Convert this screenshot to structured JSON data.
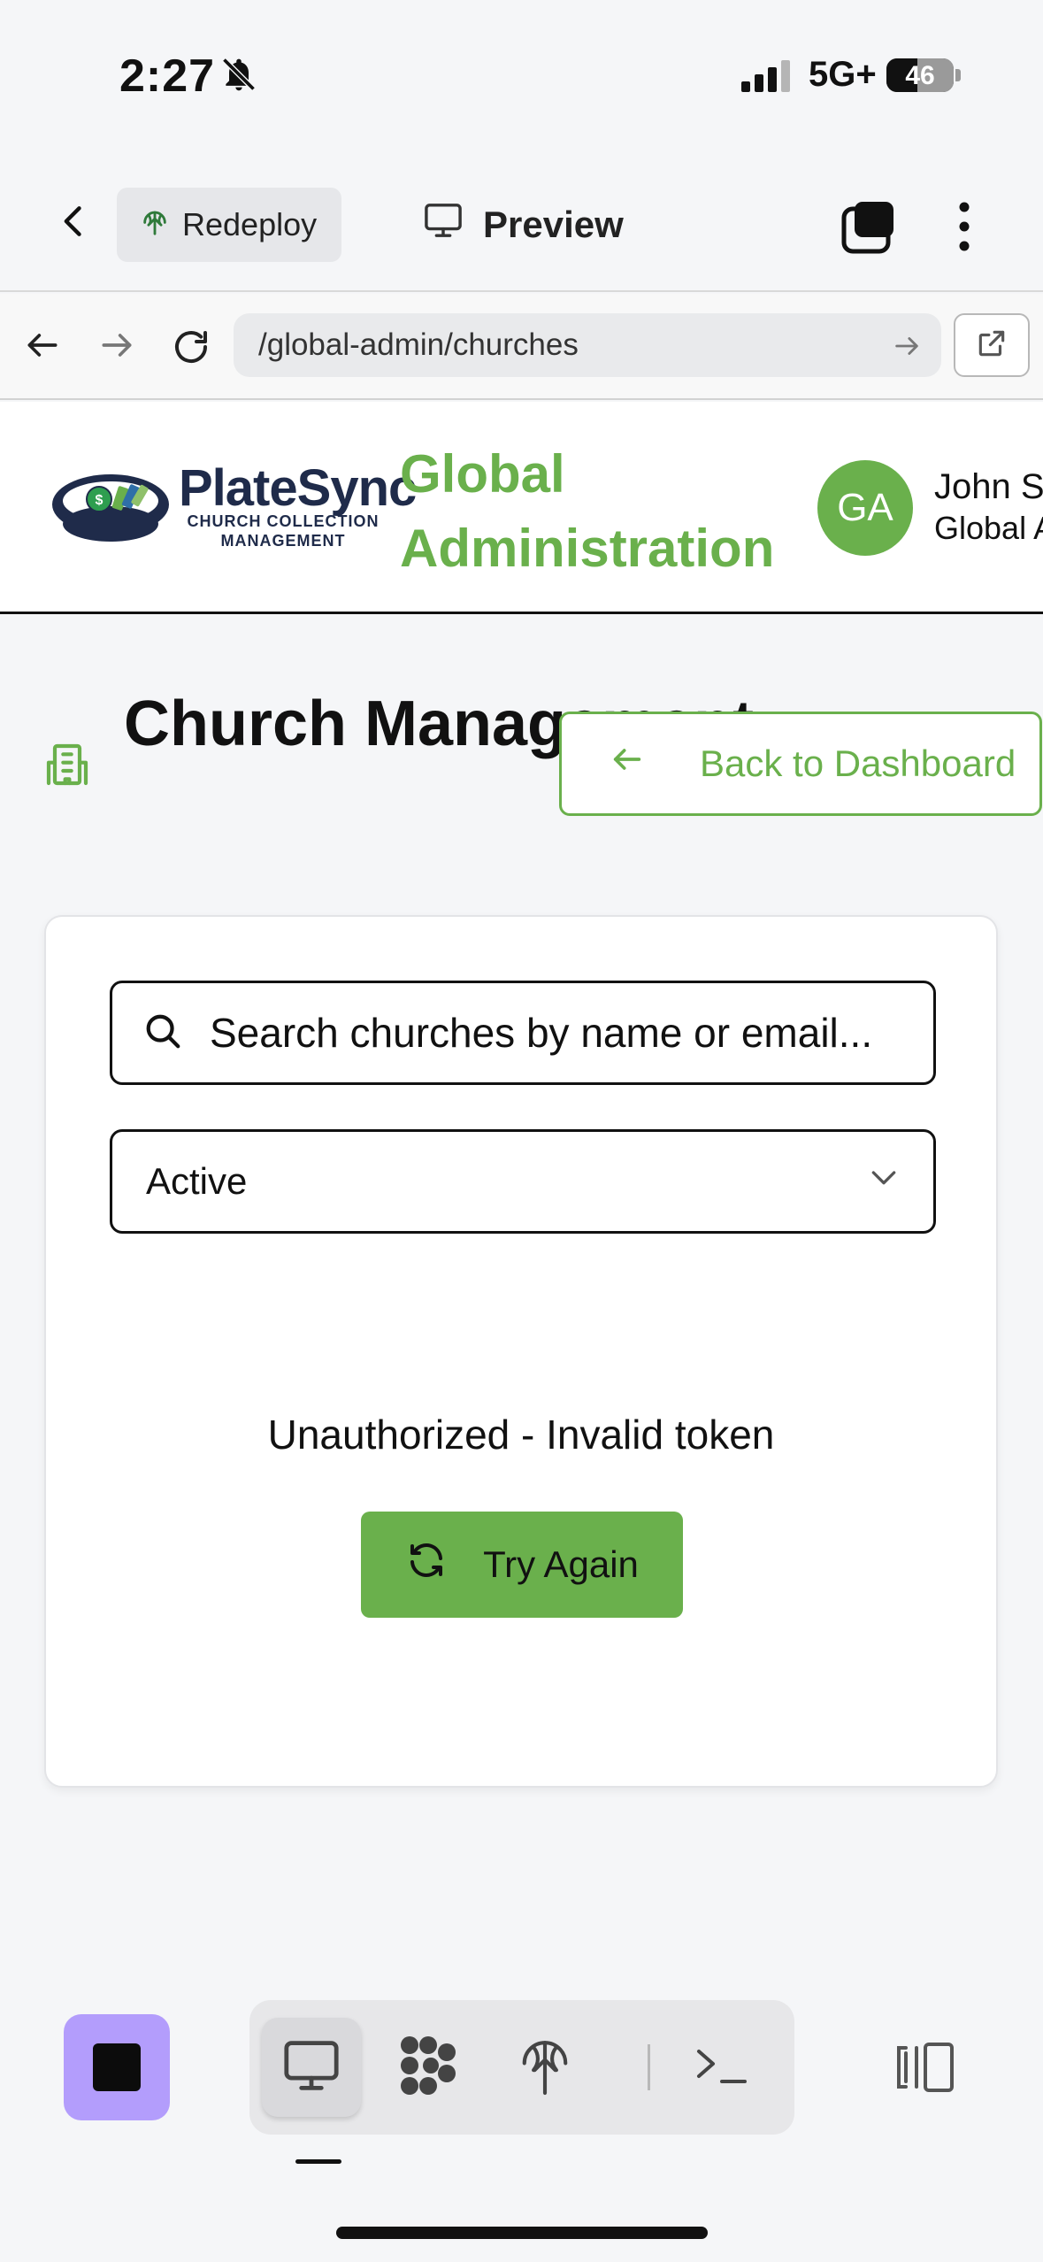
{
  "status_bar": {
    "time": "2:27",
    "network": "5G+",
    "battery": "46",
    "battery_level": 0.46
  },
  "topbar": {
    "redeploy_label": "Redeploy",
    "preview_label": "Preview"
  },
  "browser": {
    "url": "/global-admin/churches"
  },
  "header": {
    "logo_name": "PlateSync",
    "logo_tagline_1": "CHURCH COLLECTION",
    "logo_tagline_2": "MANAGEMENT",
    "title": "Global Administration",
    "avatar_initials": "GA",
    "user_name": "John S",
    "user_role": "Global A"
  },
  "page": {
    "title": "Church Management",
    "back_button": "Back to Dashboard"
  },
  "filters": {
    "search_placeholder": "Search churches by name or email...",
    "status_selected": "Active"
  },
  "error": {
    "message": "Unauthorized - Invalid token",
    "retry_label": "Try Again"
  },
  "colors": {
    "accent": "#6ab04c",
    "stop_button": "#b39dfc",
    "logo_navy": "#1f2b4a"
  },
  "icons": [
    "bell-slash-icon",
    "signal-icon",
    "chevron-left-icon",
    "globe-upload-icon",
    "monitor-icon",
    "windows-icon",
    "kebab-icon",
    "arrow-left-icon",
    "arrow-right-icon",
    "reload-icon",
    "external-link-icon",
    "building-icon",
    "search-icon",
    "chevron-down-icon",
    "refresh-icon",
    "stop-icon",
    "apps-icon",
    "terminal-icon",
    "panel-icon"
  ]
}
